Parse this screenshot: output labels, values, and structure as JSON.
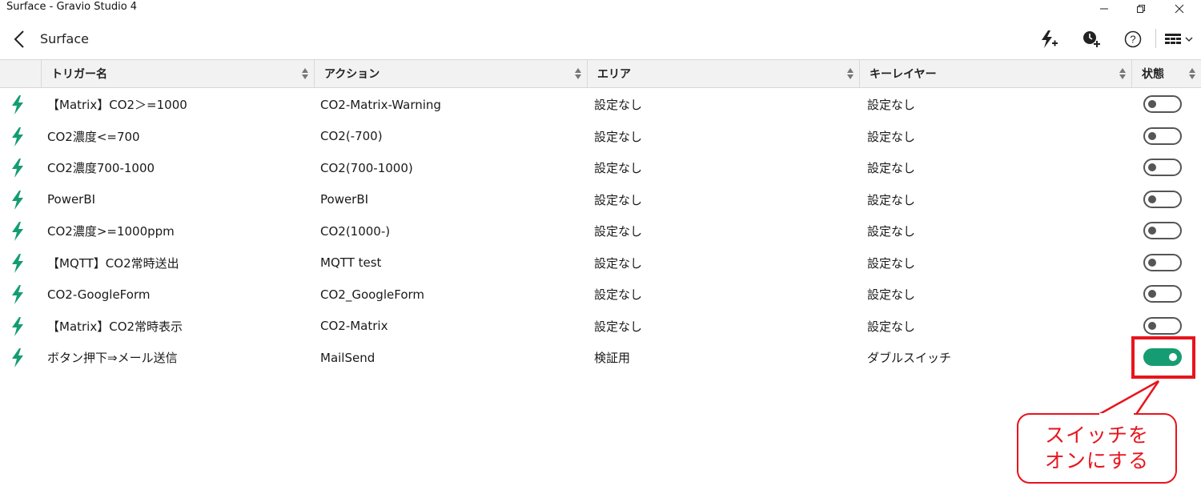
{
  "window": {
    "title": "Surface - Gravio Studio 4"
  },
  "appbar": {
    "back_icon": "back-arrow-icon",
    "title": "Surface",
    "tools": [
      "add-trigger-icon",
      "add-schedule-icon",
      "help-icon",
      "layout-menu-icon"
    ],
    "help_glyph": "?"
  },
  "table": {
    "columns": [
      "トリガー名",
      "アクション",
      "エリア",
      "キーレイヤー",
      "状態"
    ],
    "rows": [
      {
        "trigger": "【Matrix】CO2＞=1000",
        "action": "CO2-Matrix-Warning",
        "area": "設定なし",
        "layer": "設定なし",
        "enabled": false
      },
      {
        "trigger": "CO2濃度<=700",
        "action": "CO2(-700)",
        "area": "設定なし",
        "layer": "設定なし",
        "enabled": false
      },
      {
        "trigger": "CO2濃度700-1000",
        "action": "CO2(700-1000)",
        "area": "設定なし",
        "layer": "設定なし",
        "enabled": false
      },
      {
        "trigger": "PowerBI",
        "action": "PowerBI",
        "area": "設定なし",
        "layer": "設定なし",
        "enabled": false
      },
      {
        "trigger": "CO2濃度>=1000ppm",
        "action": "CO2(1000-)",
        "area": "設定なし",
        "layer": "設定なし",
        "enabled": false
      },
      {
        "trigger": "【MQTT】CO2常時送出",
        "action": "MQTT test",
        "area": "設定なし",
        "layer": "設定なし",
        "enabled": false
      },
      {
        "trigger": "CO2-GoogleForm",
        "action": "CO2_GoogleForm",
        "area": "設定なし",
        "layer": "設定なし",
        "enabled": false
      },
      {
        "trigger": "【Matrix】CO2常時表示",
        "action": "CO2-Matrix",
        "area": "設定なし",
        "layer": "設定なし",
        "enabled": false
      },
      {
        "trigger": "ボタン押下⇒メール送信",
        "action": "MailSend",
        "area": "検証用",
        "layer": "ダブルスイッチ",
        "enabled": true
      }
    ]
  },
  "annotation": {
    "line1": "スイッチを",
    "line2": "オンにする"
  },
  "colors": {
    "accent": "#169c73",
    "annotation_red": "#e8141c",
    "header_bg": "#f2f2f2"
  }
}
